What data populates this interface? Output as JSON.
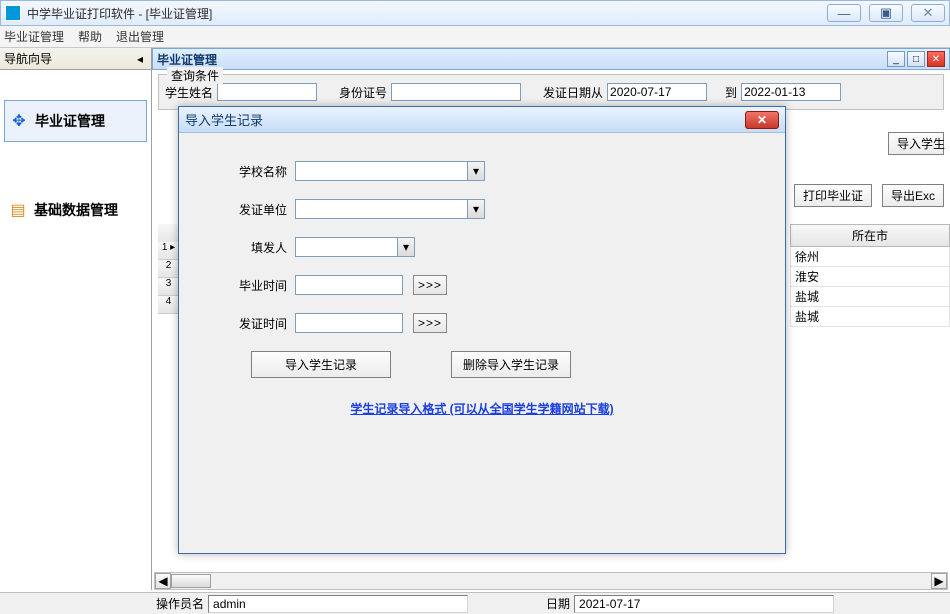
{
  "app": {
    "icon_letter": "",
    "title": "中学毕业证打印软件  - [毕业证管理]"
  },
  "window_controls": {
    "min": "—",
    "max": "▣",
    "close": "✕"
  },
  "menubar": {
    "m1": "毕业证管理",
    "m2": "帮助",
    "m3": "退出管理"
  },
  "nav": {
    "header": "导航向导",
    "pin": "◂",
    "item1": "毕业证管理",
    "item2": "基础数据管理"
  },
  "mdi": {
    "title": "毕业证管理",
    "min": "_",
    "max": "□",
    "close": "✕"
  },
  "query": {
    "legend": "查询条件",
    "name_lbl": "学生姓名",
    "id_lbl": "身份证号",
    "date_from_lbl": "发证日期从",
    "date_from": "2020-07-17",
    "date_to_lbl": "到",
    "date_to": "2022-01-13",
    "btn_import": "导入学生"
  },
  "toolbar": {
    "print": "打印毕业证",
    "export": "导出Exc"
  },
  "grid": {
    "city_header": "所在市",
    "rows": [
      "1",
      "2",
      "3",
      "4"
    ],
    "cities": [
      "徐州",
      "淮安",
      "盐城",
      "盐城"
    ]
  },
  "scroll": {
    "left": "◀",
    "right": "▶"
  },
  "status": {
    "operator_lbl": "操作员名",
    "operator": "admin",
    "date_lbl": "日期",
    "date": "2021-07-17"
  },
  "dialog": {
    "title": "导入学生记录",
    "close": "✕",
    "school_lbl": "学校名称",
    "issuer_lbl": "发证单位",
    "filler_lbl": "填发人",
    "grad_lbl": "毕业时间",
    "issue_lbl": "发证时间",
    "pick": ">>>",
    "btn_import": "导入学生记录",
    "btn_delete": "删除导入学生记录",
    "link": "学生记录导入格式 (可以从全国学生学籍网站下载)",
    "drop": "▾"
  }
}
